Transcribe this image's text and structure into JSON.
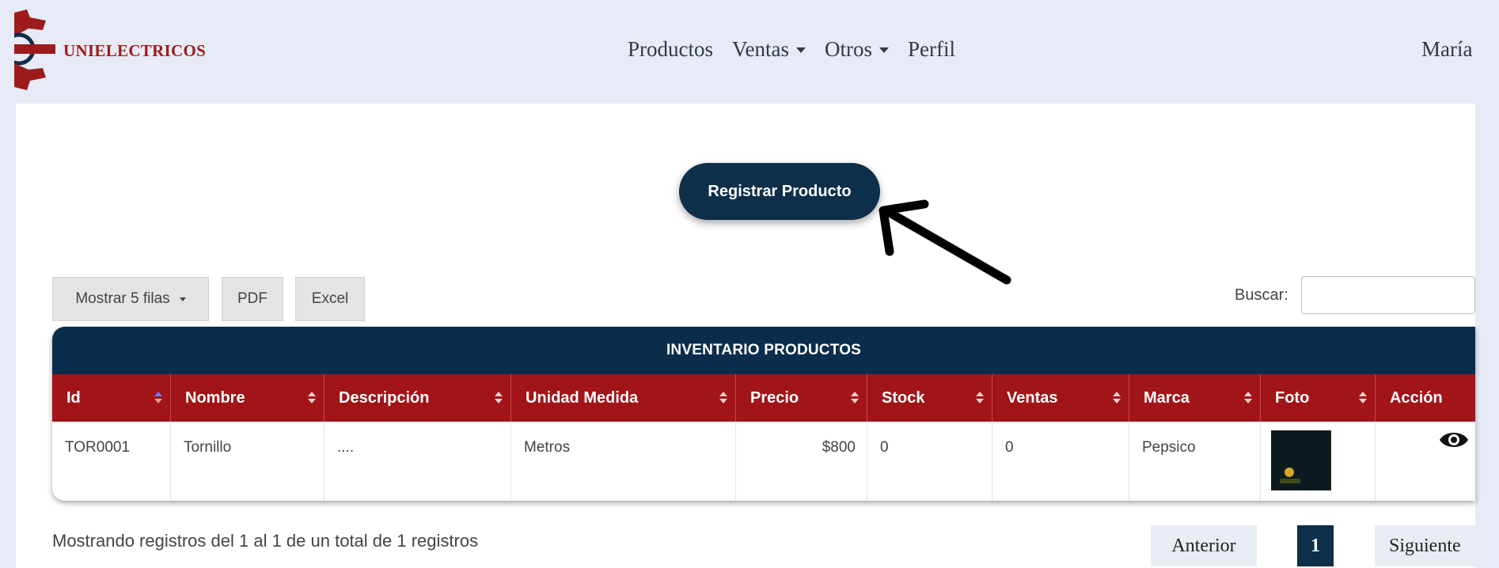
{
  "header": {
    "brand": "UNIELECTRICOS",
    "nav": [
      {
        "label": "Productos"
      },
      {
        "label": "Ventas"
      },
      {
        "label": "Otros"
      },
      {
        "label": "Perfil"
      }
    ],
    "user": "María"
  },
  "actions": {
    "register_label": "Registrar Producto"
  },
  "toolbar": {
    "show_rows_label": "Mostrar 5 filas",
    "pdf_label": "PDF",
    "excel_label": "Excel",
    "search_label": "Buscar:",
    "search_value": ""
  },
  "table": {
    "caption": "INVENTARIO PRODUCTOS",
    "columns": [
      "Id",
      "Nombre",
      "Descripción",
      "Unidad Medida",
      "Precio",
      "Stock",
      "Ventas",
      "Marca",
      "Foto",
      "Acción"
    ],
    "rows": [
      {
        "id": "TOR0001",
        "nombre": "Tornillo",
        "descripcion": "....",
        "unidad": "Metros",
        "precio": "$800",
        "stock": "0",
        "ventas": "0",
        "marca": "Pepsico"
      }
    ]
  },
  "footer": {
    "info": "Mostrando registros del 1 al 1 de un total de 1 registros",
    "prev_label": "Anterior",
    "current_page": "1",
    "next_label": "Siguiente"
  },
  "colors": {
    "brand_red": "#a11418",
    "navy": "#0e2f4a",
    "topbar_bg": "#e6ebf5"
  },
  "icons": {
    "logo": "gear-logo-icon",
    "sort": "sort-icon",
    "view": "eye-icon",
    "annotation": "arrow-icon"
  }
}
